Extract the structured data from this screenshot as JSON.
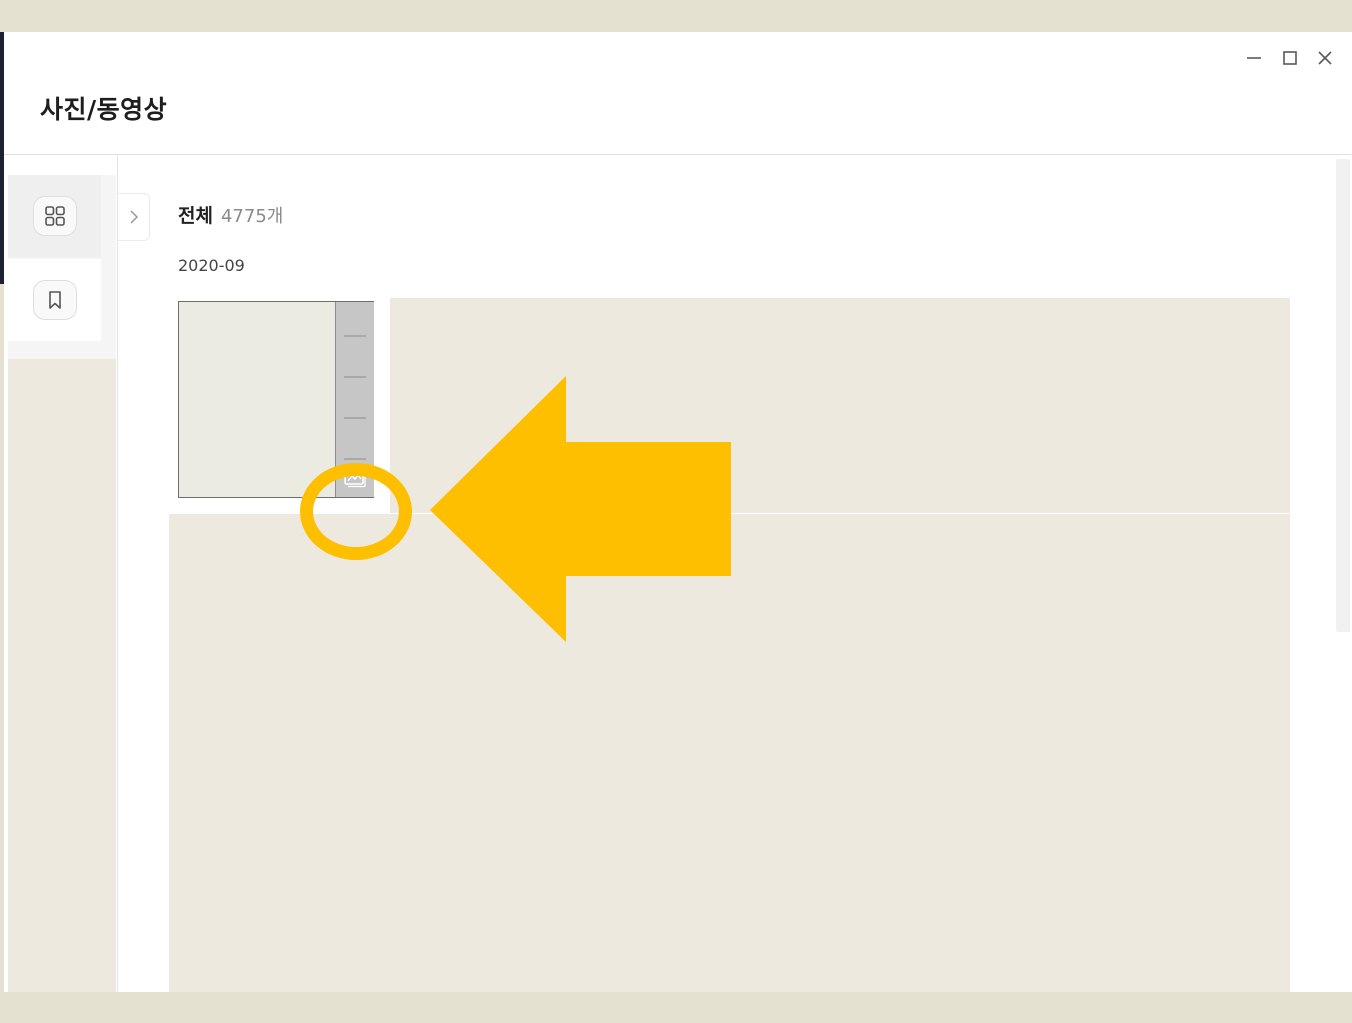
{
  "window": {
    "title": "사진/동영상",
    "controls": [
      "minimize-icon",
      "maximize-icon",
      "close-icon"
    ]
  },
  "sidebar": {
    "items": [
      {
        "icon": "grid-icon",
        "active": true
      },
      {
        "icon": "bookmark-icon",
        "active": false
      }
    ]
  },
  "main": {
    "heading_label": "전체",
    "heading_count": "4775개",
    "date_group": "2020-09"
  },
  "annotation": {
    "ring_color": "#fdbf00",
    "arrow_color": "#fdbf00",
    "arrow_direction": "left"
  },
  "colors": {
    "background_band": "#e5e1d1",
    "tile_placeholder": "#ede9df",
    "accent": "#fdbf00"
  }
}
